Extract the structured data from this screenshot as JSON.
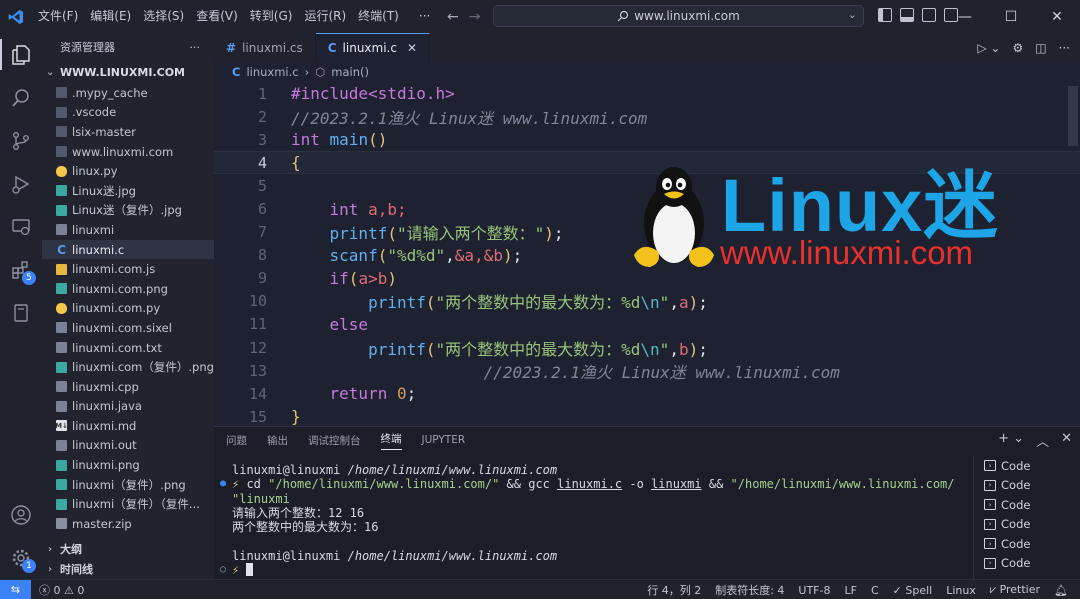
{
  "titlebar": {
    "menu": [
      "文件(F)",
      "编辑(E)",
      "选择(S)",
      "查看(V)",
      "转到(G)",
      "运行(R)",
      "终端(T)",
      "···"
    ],
    "search": "www.linuxmi.com",
    "minimize": "—",
    "maximize": "☐",
    "close": "✕"
  },
  "sidebar": {
    "title": "资源管理器",
    "more": "···",
    "folder": "WWW.LINUXMI.COM",
    "files": [
      {
        "name": ".mypy_cache",
        "icon": "folder"
      },
      {
        "name": ".vscode",
        "icon": "folder"
      },
      {
        "name": "lsix-master",
        "icon": "folder"
      },
      {
        "name": "www.linuxmi.com",
        "icon": "folder"
      },
      {
        "name": "linux.py",
        "icon": "python"
      },
      {
        "name": "Linux迷.jpg",
        "icon": "image"
      },
      {
        "name": "Linux迷（复件）.jpg",
        "icon": "image"
      },
      {
        "name": "linuxmi",
        "icon": "text"
      },
      {
        "name": "linuxmi.c",
        "icon": "c"
      },
      {
        "name": "linuxmi.com.js",
        "icon": "js"
      },
      {
        "name": "linuxmi.com.png",
        "icon": "image"
      },
      {
        "name": "linuxmi.com.py",
        "icon": "python"
      },
      {
        "name": "linuxmi.com.sixel",
        "icon": "text"
      },
      {
        "name": "linuxmi.com.txt",
        "icon": "text"
      },
      {
        "name": "linuxmi.com（复件）.png",
        "icon": "image"
      },
      {
        "name": "linuxmi.cpp",
        "icon": "text"
      },
      {
        "name": "linuxmi.java",
        "icon": "text"
      },
      {
        "name": "linuxmi.md",
        "icon": "markdown"
      },
      {
        "name": "linuxmi.out",
        "icon": "text"
      },
      {
        "name": "linuxmi.png",
        "icon": "image"
      },
      {
        "name": "linuxmi（复件）.png",
        "icon": "image"
      },
      {
        "name": "linuxmi（复件）（复件...",
        "icon": "image"
      },
      {
        "name": "master.zip",
        "icon": "zip"
      }
    ],
    "selected_index": 8,
    "outline": "大纲",
    "timeline": "时间线"
  },
  "editor": {
    "tabs": [
      {
        "label": "linuxmi.cs",
        "active": false
      },
      {
        "label": "linuxmi.c",
        "active": true
      }
    ],
    "close_glyph": "✕",
    "breadcrumb": {
      "file": "linuxmi.c",
      "sep": "›",
      "symbol": "main()"
    },
    "line_numbers": [
      "1",
      "2",
      "3",
      "4",
      "5",
      "6",
      "7",
      "8",
      "9",
      "10",
      "11",
      "12",
      "13",
      "14",
      "15"
    ],
    "current_line": 4,
    "code": {
      "l1": "#include<stdio.h>",
      "l2": "//2023.2.1渔火 Linux迷 www.linuxmi.com",
      "l3_kw": "int",
      "l3_fn": "main",
      "l6_kw": "int",
      "l6_rest": "a,b;",
      "l7_fn": "printf",
      "l7_str": "\"请输入两个整数：\"",
      "l8_fn": "scanf",
      "l8_str": "\"%d%d\"",
      "l8_args": "&a,&b",
      "l9_kw": "if",
      "l9_cond": "a>b",
      "l10_fn": "printf",
      "l10_str": "\"两个整数中的最大数为：%d",
      "l10_esc": "\\n",
      "l10_var": "a",
      "l11_kw": "else",
      "l12_fn": "printf",
      "l12_str": "\"两个整数中的最大数为：%d",
      "l12_esc": "\\n",
      "l12_var": "b",
      "l13": "//2023.2.1渔火 Linux迷 www.linuxmi.com",
      "l14_kw": "return",
      "l14_num": "0"
    }
  },
  "logo": {
    "title": "Linux迷",
    "url": "www.linuxmi.com"
  },
  "panel": {
    "tabs": [
      "问题",
      "输出",
      "调试控制台",
      "终端",
      "JUPYTER"
    ],
    "active_tab": "终端",
    "terminal": {
      "prompt_user": "linuxmi@linuxmi",
      "prompt_path": "/home/linuxmi/www.linuxmi.com",
      "cmd_prefix": "cd ",
      "cmd_path": "\"/home/linuxmi/www.linuxmi.com/\"",
      "cmd_mid1": " && gcc ",
      "cmd_file": "linuxmi.c",
      "cmd_mid2": " -o ",
      "cmd_out": "linuxmi",
      "cmd_mid3": " && ",
      "cmd_run": "\"/home/linuxmi/www.linuxmi.com/",
      "cmd_run2": "\"linuxmi",
      "out1": "请输入两个整数：12 16",
      "out2": "两个整数中的最大数为：16",
      "prompt2_user": "linuxmi@linuxmi",
      "prompt2_path": "/home/linuxmi/www.linuxmi.com"
    },
    "terminals": [
      "Code",
      "Code",
      "Code",
      "Code",
      "Code",
      "Code"
    ]
  },
  "statusbar": {
    "errors": "0",
    "warnings": "0",
    "position": "行 4，列 2",
    "indent": "制表符长度: 4",
    "encoding": "UTF-8",
    "eol": "LF",
    "language": "C",
    "spell": "Spell",
    "os": "Linux",
    "prettier": "Prettier"
  },
  "colors": {
    "accent": "#3b82f6",
    "logo_blue": "#1da5e8",
    "logo_red": "#e9302a"
  }
}
